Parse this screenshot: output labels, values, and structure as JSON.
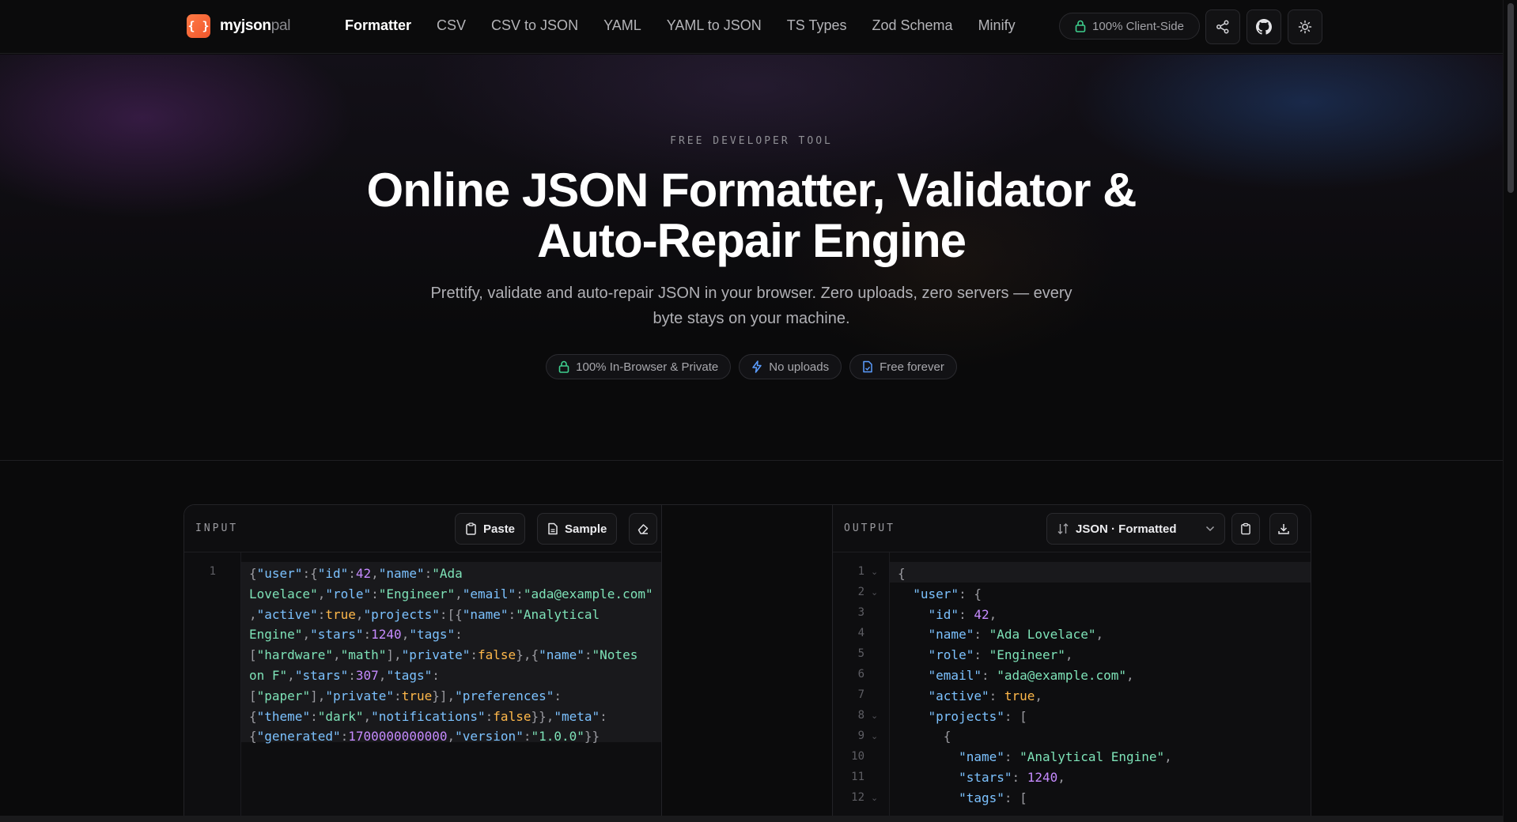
{
  "logo": {
    "mark": "{ }",
    "brand": "myjson",
    "brand_suffix": "pal"
  },
  "nav": {
    "links": [
      {
        "label": "Formatter",
        "active": true
      },
      {
        "label": "CSV"
      },
      {
        "label": "CSV to JSON"
      },
      {
        "label": "YAML"
      },
      {
        "label": "YAML to JSON"
      },
      {
        "label": "TS Types"
      },
      {
        "label": "Zod Schema"
      },
      {
        "label": "Minify"
      }
    ],
    "client_badge": "100% Client-Side",
    "icons": [
      "share-icon",
      "github-icon",
      "sun-icon"
    ]
  },
  "hero": {
    "eyebrow": "FREE DEVELOPER TOOL",
    "title_line1": "Online JSON Formatter, Validator &",
    "title_line2": "Auto-Repair Engine",
    "subtitle_line1": "Prettify, validate and auto-repair JSON in your browser. Zero uploads, zero servers — every",
    "subtitle_line2": "byte stays on your machine.",
    "pills": [
      {
        "label": "100% In-Browser & Private",
        "icon": "lock-icon"
      },
      {
        "label": "No uploads",
        "icon": "bolt-icon"
      },
      {
        "label": "Free forever",
        "icon": "file-icon"
      }
    ]
  },
  "input_panel": {
    "label": "INPUT",
    "paste_label": "Paste",
    "sample_label": "Sample",
    "line_numbers": [
      "1"
    ]
  },
  "output_panel": {
    "label": "OUTPUT",
    "mode_label": "JSON · Formatted",
    "line_numbers": [
      "1",
      "2",
      "3",
      "4",
      "5",
      "6",
      "7",
      "8",
      "9",
      "10",
      "11",
      "12"
    ]
  },
  "colors": {
    "accent": "#f0562c",
    "key": "#7cc2ff",
    "string": "#7ee3b8",
    "number": "#c68bff",
    "boolean": "#ffb84a"
  }
}
